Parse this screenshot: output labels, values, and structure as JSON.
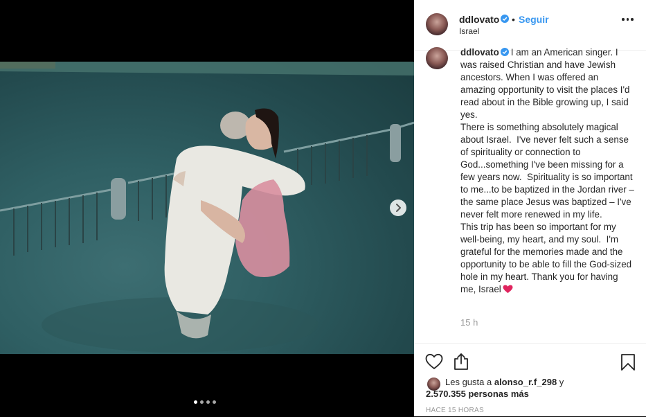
{
  "post": {
    "username": "ddlovato",
    "follow_label": "Seguir",
    "bullet": "•",
    "location": "Israel",
    "caption_user": "ddlovato",
    "caption_text": "I am an American singer. I was raised Christian and have Jewish ancestors. When I was offered an amazing opportunity to visit the places I'd read about in the Bible growing up, I said yes.\nThere is something absolutely magical about Israel.  I've never felt such a sense of spirituality or connection to God...something I've been missing for a few years now.  Spirituality is so important to me...to be baptized in the Jordan river – the same place Jesus was baptized – I've never felt more renewed in my life.\nThis trip has been so important for my well-being, my heart, and my soul.  I'm grateful for the memories made and the opportunity to be able to fill the God-sized hole in my heart. Thank you for having me, Israel",
    "relative_time": "15 h",
    "likes_prefix": "Les gusta a",
    "likes_user": "alonso_r.f_298",
    "likes_and": "y",
    "likes_count": "2.570.355 personas más",
    "timestamp": "HACE 15 HORAS"
  },
  "carousel": {
    "total": 4,
    "active": 1
  },
  "icons": {
    "verified": "verified-badge-icon",
    "more": "more-options-icon",
    "next": "chevron-right-icon",
    "like": "heart-outline-icon",
    "share": "share-icon",
    "save": "bookmark-icon",
    "caption_emoji": "red-heart-emoji"
  },
  "colors": {
    "link": "#3897f0",
    "text": "#262626",
    "muted": "#999999",
    "verified": "#3897f0"
  }
}
